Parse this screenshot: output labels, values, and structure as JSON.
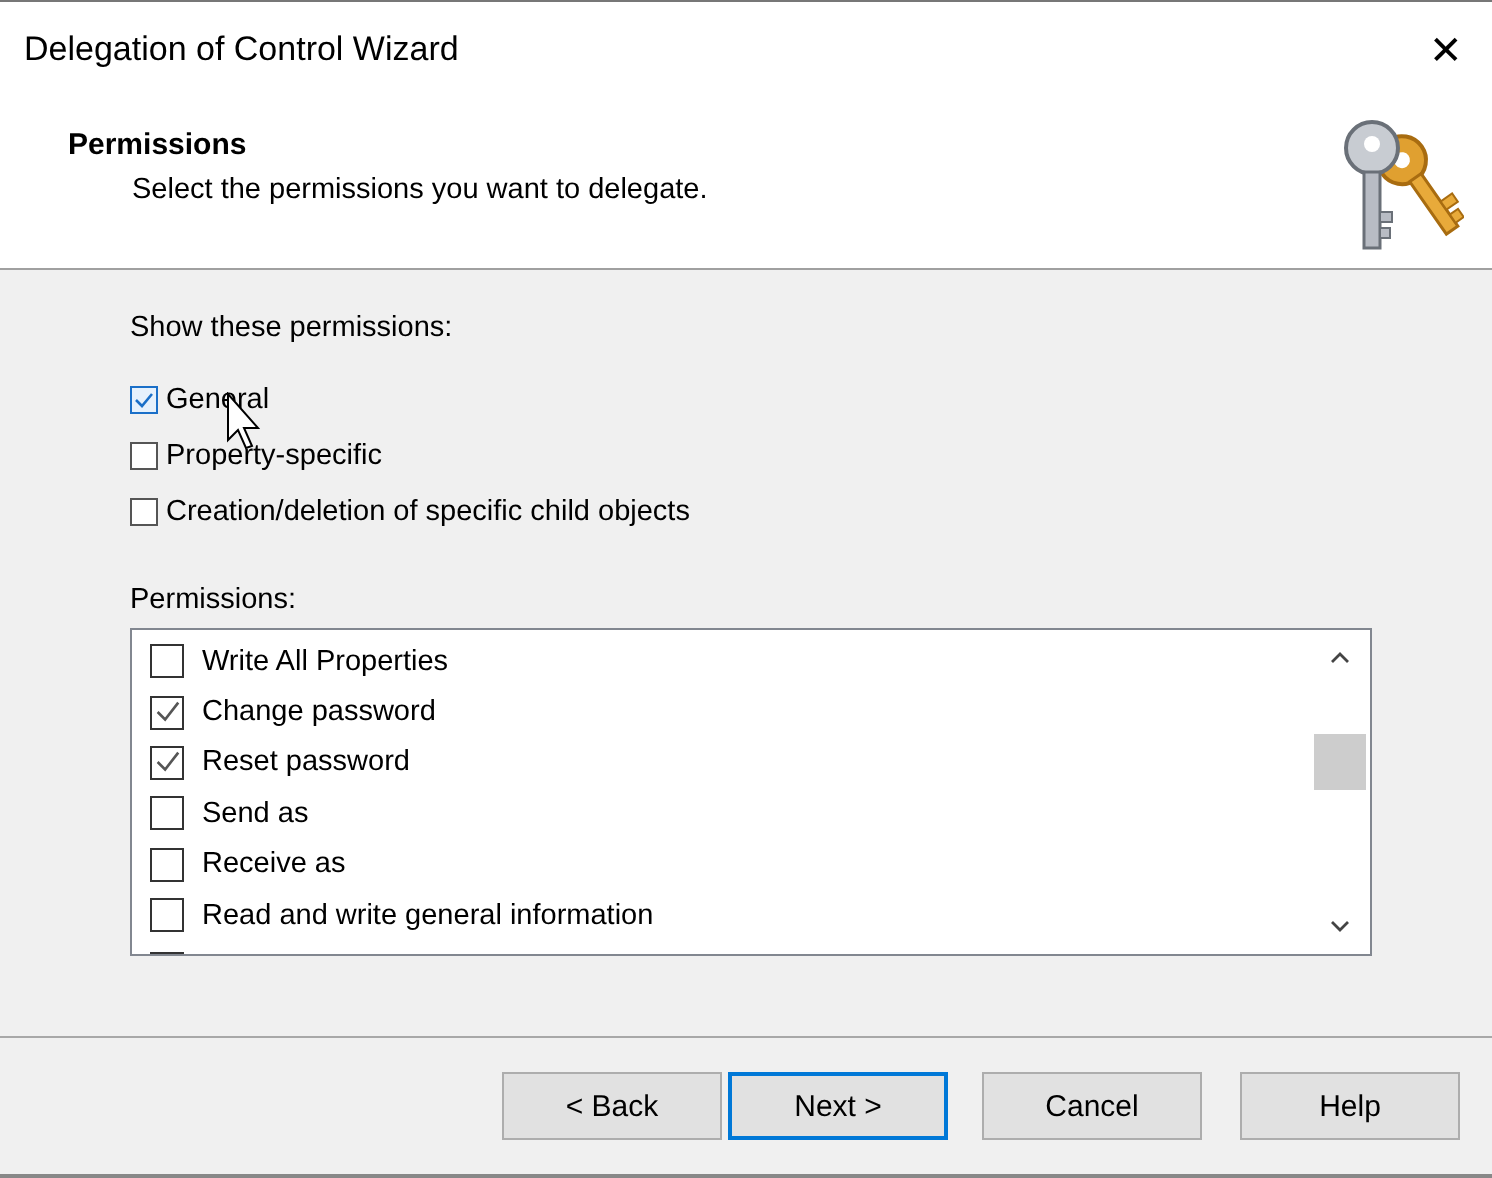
{
  "window": {
    "title": "Delegation of Control Wizard",
    "close": "✕"
  },
  "header": {
    "title": "Permissions",
    "subtitle": "Select the permissions you want to delegate."
  },
  "filter": {
    "label": "Show these permissions:",
    "options": [
      {
        "label": "General",
        "checked": true
      },
      {
        "label": "Property-specific",
        "checked": false
      },
      {
        "label": "Creation/deletion of specific child objects",
        "checked": false
      }
    ]
  },
  "permissions": {
    "label": "Permissions:",
    "items": [
      {
        "label": "Write All Properties",
        "checked": false
      },
      {
        "label": "Change password",
        "checked": true
      },
      {
        "label": "Reset password",
        "checked": true
      },
      {
        "label": "Send as",
        "checked": false
      },
      {
        "label": "Receive as",
        "checked": false
      },
      {
        "label": "Read and write general information",
        "checked": false
      }
    ]
  },
  "buttons": [
    {
      "label": "< Back",
      "focused": false
    },
    {
      "label": "Next >",
      "focused": true
    },
    {
      "label": "Cancel",
      "focused": false
    },
    {
      "label": "Help",
      "focused": false
    }
  ]
}
